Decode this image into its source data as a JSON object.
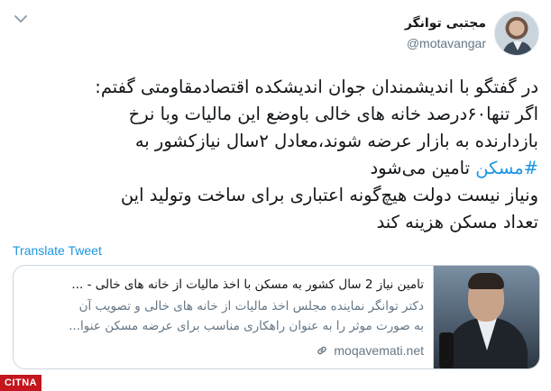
{
  "author": {
    "display_name": "مجتبی توانگر",
    "handle": "@motavangar"
  },
  "tweet": {
    "lines": [
      "در گفتگو با اندیشمندان جوان اندیشکده اقتصادمقاومتی گفتم:",
      "اگر تنها۶۰درصد خانه های خالی باوضع این مالیات وبا نرخ",
      "بازدارنده به بازار عرضه شوند،معادل ۲سال نیازکشور به",
      "#مسکن",
      " تامین می‌شود",
      "ونیاز نیست دولت هیچ‌گونه اعتباری برای ساخت وتولید این",
      "تعداد مسکن هزینه کند"
    ],
    "translate_label": "Translate Tweet"
  },
  "card": {
    "title": "تامین نیاز 2 سال کشور به مسکن با اخذ مالیات از خانه های خالی - ...",
    "desc_lines": [
      "دکتر توانگر نماینده مجلس اخذ مالیات از خانه های خالی و تصویب آن",
      "به صورت موثر را به عنوان راهکاری مناسب برای عرضه مسکن عنوا..."
    ],
    "domain": "moqavemati.net"
  },
  "watermark": "CITNA",
  "icons": {
    "chevron": "chevron-down-icon",
    "link": "link-icon"
  },
  "colors": {
    "link_blue": "#1b95e0",
    "muted": "#657786",
    "border": "#ccd6dd",
    "watermark_red": "#c4161c"
  }
}
